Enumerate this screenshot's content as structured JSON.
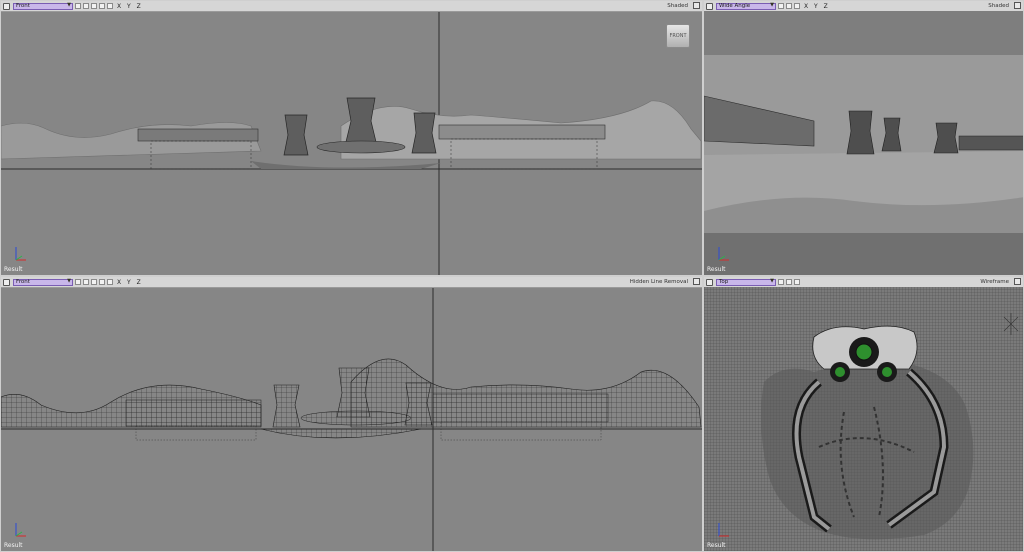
{
  "colors": {
    "purple_select": "#c9b7ea",
    "viewport_bg": "#868686",
    "toolbar_bg": "#d6d6d6"
  },
  "viewports": [
    {
      "view": "Front",
      "axes": "X Y Z",
      "mode": "Shaded",
      "label": "Result",
      "cube_label": "FRONT"
    },
    {
      "view": "Wide Angle",
      "axes": "X Y Z",
      "mode": "Shaded",
      "label": "Result"
    },
    {
      "view": "Front",
      "axes": "X Y Z",
      "mode": "Hidden Line Removal",
      "label": "Result"
    },
    {
      "view": "Top",
      "axes": "",
      "mode": "Wireframe",
      "label": "Result"
    }
  ]
}
